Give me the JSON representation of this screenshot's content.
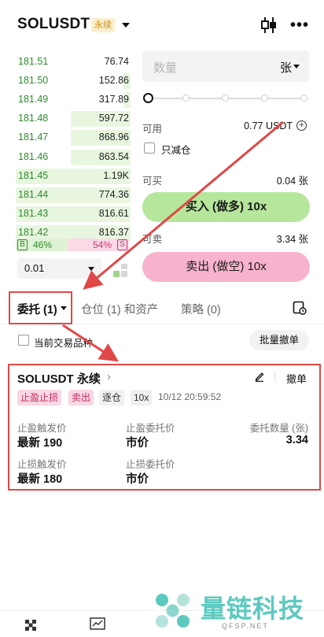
{
  "header": {
    "symbol": "SOLUSDT",
    "contract_tag": "永续",
    "icons": [
      "chevron-down-icon",
      "candlestick-icon",
      "more-icon"
    ]
  },
  "orderbook": {
    "bids": [
      {
        "price": "181.51",
        "qty": "76.74",
        "depth": 0.0
      },
      {
        "price": "181.50",
        "qty": "152.86",
        "depth": 0.06
      },
      {
        "price": "181.49",
        "qty": "317.89",
        "depth": 0.06
      },
      {
        "price": "181.48",
        "qty": "597.72",
        "depth": 0.52
      },
      {
        "price": "181.47",
        "qty": "868.96",
        "depth": 0.52
      },
      {
        "price": "181.46",
        "qty": "863.54",
        "depth": 0.52
      },
      {
        "price": "181.45",
        "qty": "1.19K",
        "depth": 1.0
      },
      {
        "price": "181.44",
        "qty": "774.36",
        "depth": 1.0
      },
      {
        "price": "181.43",
        "qty": "816.61",
        "depth": 1.0
      },
      {
        "price": "181.42",
        "qty": "816.37",
        "depth": 1.0
      }
    ],
    "buy_label": "B",
    "buy_pct": "46%",
    "sell_pct": "54%",
    "sell_label": "S",
    "buy_ratio": 0.46,
    "precision": "0.01"
  },
  "form": {
    "qty_placeholder": "数量",
    "unit": "张",
    "leverage_slider_value": 0,
    "available_label": "可用",
    "available_value": "0.77 USDT",
    "reduce_only_label": "只减仓",
    "can_buy_label": "可买",
    "can_buy_value": "0.04 张",
    "buy_button": "买入 (做多) 10x",
    "can_sell_label": "可卖",
    "can_sell_value": "3.34 张",
    "sell_button": "卖出 (做空) 10x"
  },
  "tabs": {
    "orders": "委托 (1)",
    "positions": "仓位 (1) 和资产",
    "strategy": "策略 (0)"
  },
  "filter": {
    "current_symbol_label": "当前交易品种",
    "cancel_all": "批量撤单"
  },
  "order": {
    "symbol": "SOLUSDT 永续",
    "cancel": "撤单",
    "tags": [
      "止盈止损",
      "卖出",
      "逐仓",
      "10x"
    ],
    "time": "10/12 20:59:52",
    "tp_trigger_label": "止盈触发价",
    "tp_trigger_value": "最新 190",
    "tp_order_label": "止盈委托价",
    "tp_order_value": "市价",
    "qty_label": "委托数量 (张)",
    "qty_value": "3.34",
    "sl_trigger_label": "止损触发价",
    "sl_trigger_value": "最新 180",
    "sl_order_label": "止损委托价",
    "sl_order_value": "市价"
  },
  "watermark": {
    "brand": "量链科技",
    "url": "QFSP.NET"
  },
  "colors": {
    "bid_green": "#2e8b2e",
    "buy_button": "#b6e69b",
    "sell_button": "#f7b2cd",
    "annotation_red": "#e04848"
  }
}
